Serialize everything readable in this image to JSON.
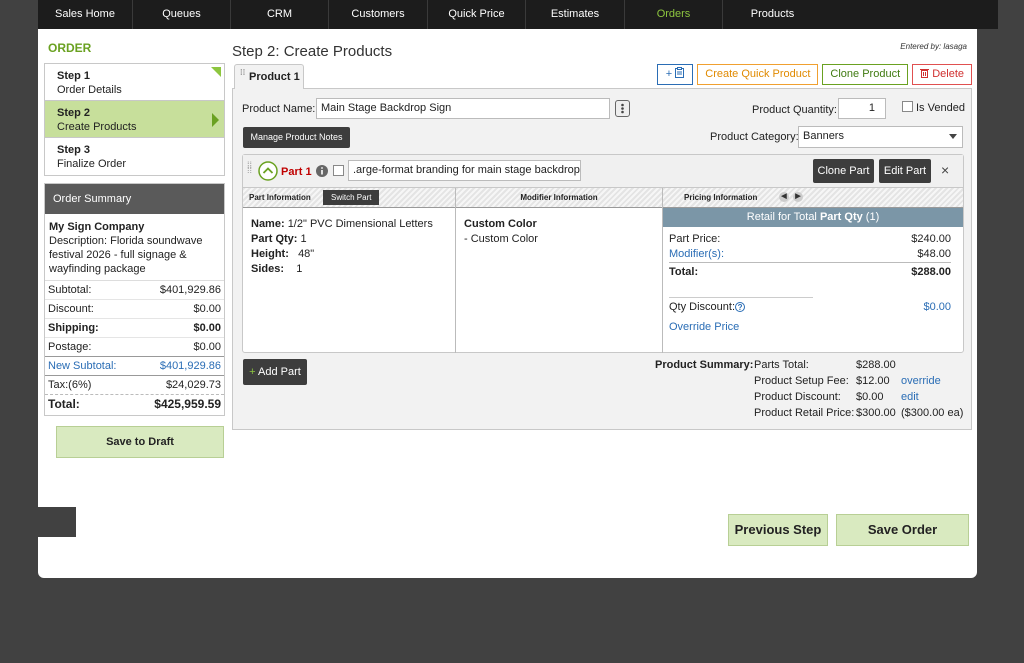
{
  "nav": [
    {
      "label": "Sales Home",
      "active": false
    },
    {
      "label": "Queues",
      "active": false
    },
    {
      "label": "CRM",
      "active": false
    },
    {
      "label": "Customers",
      "active": false
    },
    {
      "label": "Quick Price",
      "active": false
    },
    {
      "label": "Estimates",
      "active": false
    },
    {
      "label": "Orders",
      "active": true
    },
    {
      "label": "Products",
      "active": false
    }
  ],
  "sidebar": {
    "title": "ORDER",
    "steps": [
      {
        "num": "Step 1",
        "label": "Order Details"
      },
      {
        "num": "Step 2",
        "label": "Create Products"
      },
      {
        "num": "Step 3",
        "label": "Finalize Order"
      }
    ],
    "summary": {
      "header": "Order Summary",
      "company": "My Sign Company",
      "description": "Description:  Florida soundwave festival 2026 - full signage & wayfinding package",
      "rows": [
        {
          "label": "Subtotal:",
          "value": "$401,929.86"
        },
        {
          "label": "Discount:",
          "value": "$0.00"
        },
        {
          "label": "Shipping:",
          "value": "$0.00"
        },
        {
          "label": "Postage:",
          "value": "$0.00"
        },
        {
          "label": "New Subtotal:",
          "value": "$401,929.86"
        },
        {
          "label": "Tax:(6%)",
          "value": "$24,029.73"
        },
        {
          "label": "Total:",
          "value": "$425,959.59"
        }
      ]
    },
    "save_draft": "Save to Draft"
  },
  "main": {
    "title": "Step 2: Create Products",
    "entered_by": "Entered by: lasaga",
    "tab": "Product 1",
    "buttons": {
      "add_icon": "+",
      "create_quick": "Create Quick Product",
      "clone": "Clone Product",
      "delete": "Delete"
    },
    "product_name_label": "Product Name:",
    "product_name": "Main Stage Backdrop Sign",
    "qty_label": "Product Quantity:",
    "qty": "1",
    "is_vended": "Is Vended",
    "manage_notes": "Manage Product Notes",
    "category_label": "Product Category:",
    "category": "Banners",
    "part": {
      "label": "Part 1",
      "description": ".arge-format branding for main stage backdrop",
      "clone": "Clone Part",
      "edit": "Edit Part",
      "close": "×",
      "col_part": "Part Information",
      "switch_part": "Switch Part",
      "col_modifier": "Modifier Information",
      "col_pricing": "Pricing Information",
      "info": [
        {
          "k": "Name:",
          "v": "1/2\" PVC Dimensional Letters"
        },
        {
          "k": "Part Qty:",
          "v": "1"
        },
        {
          "k": "Height:",
          "v": "48\""
        },
        {
          "k": "Sides:",
          "v": "1"
        }
      ],
      "modifier_title": "Custom Color",
      "modifier_item": "- Custom Color",
      "retail_prefix": "Retail for Total ",
      "retail_bold": "Part Qty",
      "retail_suffix": " (1)",
      "price_rows": [
        {
          "k": "Part Price:",
          "v": "$240.00"
        },
        {
          "k": "Modifier(s):",
          "v": "$48.00"
        },
        {
          "k": "Total:",
          "v": "$288.00"
        }
      ],
      "qty_discount_label": "Qty Discount:",
      "qty_discount": "$0.00",
      "override_price": "Override Price"
    },
    "add_part": "+ Add Part",
    "product_summary": {
      "label": "Product Summary:",
      "rows": [
        {
          "k": "Parts Total:",
          "v": "$288.00",
          "extra": ""
        },
        {
          "k": "Product Setup Fee:",
          "v": "$12.00",
          "extra": "override"
        },
        {
          "k": "Product Discount:",
          "v": "$0.00",
          "extra": "edit"
        },
        {
          "k": "Product Retail Price:",
          "v": "$300.00",
          "extra": "($300.00 ea)"
        }
      ]
    },
    "previous_step": "Previous Step",
    "save_order": "Save Order"
  },
  "colors": {
    "accent": "#8dc63f",
    "link": "#2a6db5",
    "part_red": "#c00000"
  }
}
